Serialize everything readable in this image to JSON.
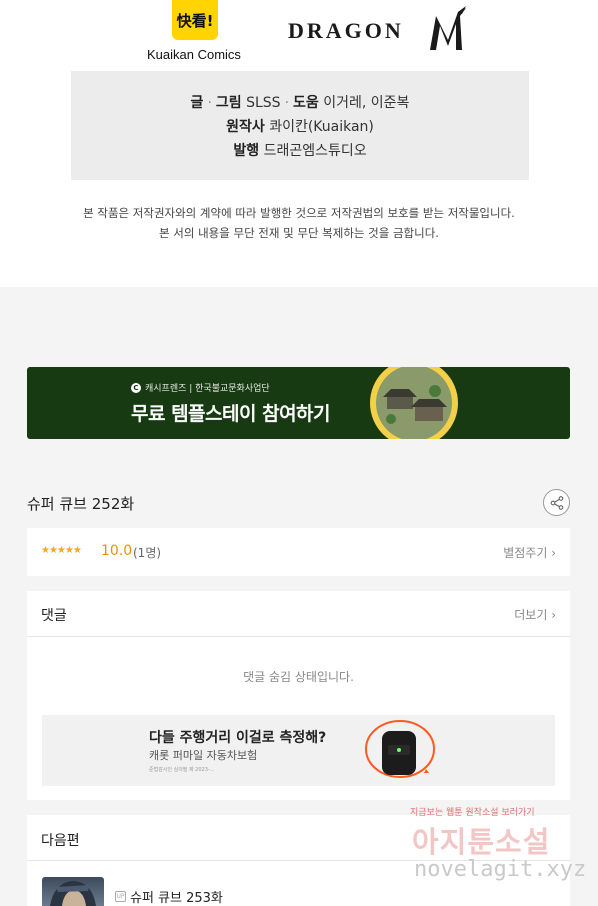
{
  "header": {
    "kuaikan_logo_glyph": "快看!",
    "kuaikan_logo_text": "Kuaikan Comics",
    "dragon_logo_text": "DRAGON"
  },
  "credits": {
    "line1": {
      "label_text": "글",
      "label_art": "그림",
      "author": "SLSS",
      "label_assist": "도움",
      "assistants": "이거레, 이준복"
    },
    "line2": {
      "label": "원작사",
      "value": "콰이칸(Kuaikan)"
    },
    "line3": {
      "label": "발행",
      "value": "드래곤엠스튜디오"
    }
  },
  "notice": {
    "line1": "본 작품은 저작권자와의 계약에 따라 발행한 것으로 저작권법의 보호를 받는 저작물입니다.",
    "line2": "본 서의 내용을 무단 전재 및 무단 복제하는 것을 금합니다."
  },
  "banner": {
    "sponsor_icon": "C",
    "sponsor": "캐시프렌즈 | 한국불교문화사업단",
    "title": "무료 템플스테이 참여하기"
  },
  "episode": {
    "title": "슈퍼 큐브 252화"
  },
  "rating": {
    "stars": "★★★★★",
    "score": "10.0",
    "count": "(1명)",
    "rate_link": "별점주기 ›"
  },
  "comments": {
    "label": "댓글",
    "more": "더보기 ›",
    "hidden_message": "댓글 숨김 상태입니다."
  },
  "ad": {
    "title": "다들 주행거리 이걸로 측정해?",
    "subtitle": "캐롯 퍼마일 자동차보험",
    "fine_print": "준법감시인 심의필 제 2023-..."
  },
  "next": {
    "label": "다음편",
    "badge": "UP",
    "title": "슈퍼 큐브 253화"
  },
  "watermark": {
    "top": "지금보는 웹툰 원작소설 보러가기",
    "big": "아지툰소설",
    "url": "novelagit.xyz"
  },
  "colors": {
    "banner_bg": "#173a12",
    "rating_accent": "#e69500",
    "page_bg": "#f4f4f4"
  }
}
